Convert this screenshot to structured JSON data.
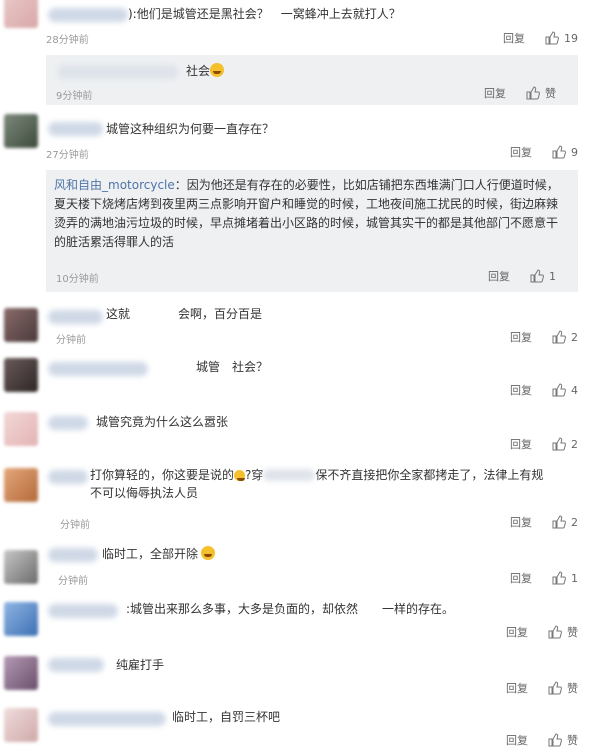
{
  "labels": {
    "reply": "回复",
    "like": "赞"
  },
  "comments": [
    {
      "text": "):他们是城管还是黑社会？　一窝蜂冲上去就打人？",
      "time": "28分钟前",
      "likes": "19"
    },
    {
      "text": "城管这种组织为何要一直存在？",
      "time": "27分钟前",
      "likes": "9"
    },
    {
      "text": "这就　　　　会啊，百分百是",
      "time": "　分钟前",
      "likes": "2"
    },
    {
      "text": "城管　社会？",
      "time": "",
      "likes": "4"
    },
    {
      "text": "城管究竟为什么这么嚣张",
      "time": "",
      "likes": "2"
    },
    {
      "text_line1": "打你算轻的，你这要是说的",
      "text_mid": "?穿",
      "text_line1b": "保不齐直接把你全家都拷走了，法律上有规",
      "text_line2": "不可以侮辱执法人员",
      "time": "分钟前",
      "likes": "2"
    },
    {
      "text": "临时工，全部开除",
      "time": "分钟前",
      "likes": "1"
    },
    {
      "text": ":城管出来那么多事，大多是负面的，却依然　　一样的存在。",
      "time": "",
      "likes": "赞"
    },
    {
      "text": "纯雇打手",
      "time": "",
      "likes": "赞"
    },
    {
      "text": "临时工，自罚三杯吧",
      "time": "",
      "likes": "赞"
    }
  ],
  "subs": [
    {
      "text": "社会",
      "time": "9分钟前",
      "likes": "赞"
    },
    {
      "name": "风和自由_motorcycle",
      "text": "：因为他还是有存在的必要性，比如店铺把东西堆满门口人行便道时候，夏天楼下烧烤店烤到夜里两三点影响开窗户和睡觉的时候，工地夜间施工扰民的时候，街边麻辣烫弄的满地油污垃圾的时候，早点摊堵着出小区路的时候，城管其实干的都是其他部门不愿意干的脏活累活得罪人的活",
      "time": "10分钟前",
      "likes": "1"
    }
  ],
  "colors": {
    "link": "#4f74a8",
    "muted": "#9a9a9a",
    "sub_bg": "#eef0f2"
  }
}
